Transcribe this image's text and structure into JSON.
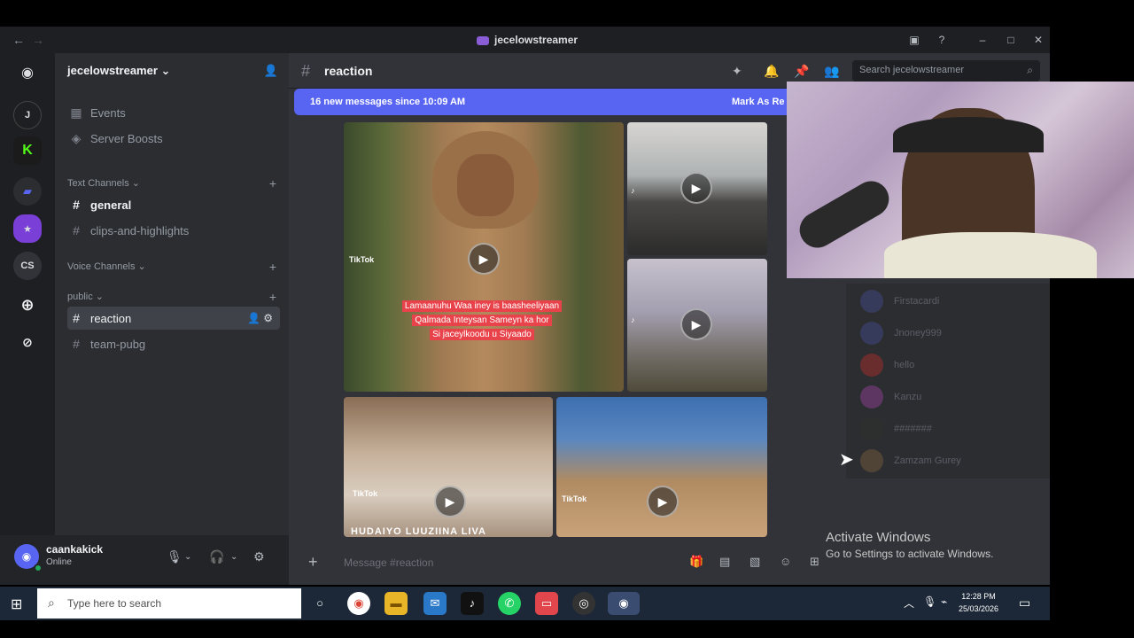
{
  "window": {
    "title": "jecelowstreamer"
  },
  "server": {
    "name": "jecelowstreamer",
    "name_chevron": "⌄"
  },
  "rail": {
    "items": [
      "J",
      "",
      "",
      "",
      "CS",
      "+",
      ""
    ]
  },
  "sidebar": {
    "events_label": "Events",
    "boosts_label": "Server Boosts",
    "categories": {
      "text": "Text Channels",
      "voice": "Voice Channels",
      "public": "public"
    },
    "text_channels": [
      "general",
      "clips-and-highlights"
    ],
    "public_channels": [
      "reaction",
      "team-pubg"
    ]
  },
  "user": {
    "name": "caankakick",
    "status": "Online"
  },
  "channel": {
    "name": "reaction",
    "search_placeholder": "Search jecelowstreamer",
    "new_messages": "16 new messages since 10:09 AM",
    "mark_as_read": "Mark As Re",
    "composer_placeholder": "Message #reaction"
  },
  "media": {
    "caption_lines": [
      "Lamaanuhu Waa iney is baasheeliyaan",
      "Qalmada Inteysan Sameyn ka hor",
      "Si jaceylkoodu u Siyaado"
    ],
    "tiktok_label": "TikTok",
    "bottom_text": "HUDAIYO LUUZIINA LIVA"
  },
  "members": [
    "Firstacardi",
    "Jnoney999",
    "hello",
    "Kanzu",
    "#######",
    "Zamzam Gurey"
  ],
  "activate": {
    "line1": "Activate Windows",
    "line2": "Go to Settings to activate Windows."
  },
  "taskbar": {
    "search_placeholder": "Type here to search",
    "time": "12:28 PM",
    "date": "25/03/2026"
  },
  "colors": {
    "accent": "#5865f2",
    "online": "#23a55a",
    "bg_rail": "#1e1f22",
    "bg_sidebar": "#2b2d31",
    "bg_main": "#313338",
    "caption_red": "#e8434b",
    "taskbar": "#1c2737"
  }
}
